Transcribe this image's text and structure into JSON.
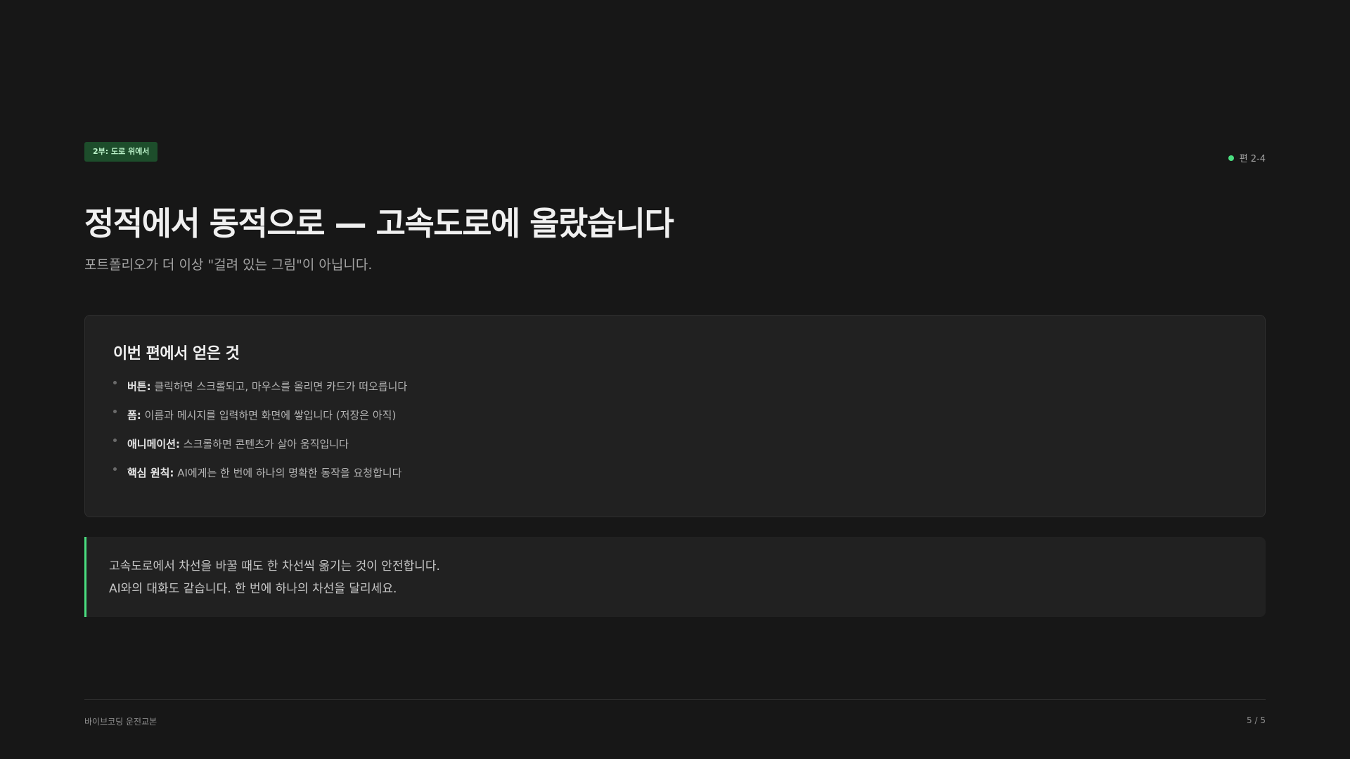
{
  "header": {
    "part_badge": "2부: 도로 위에서",
    "episode_label": "편 2-4"
  },
  "title": "정적에서 동적으로 — 고속도로에 올랐습니다",
  "subtitle": "포트폴리오가 더 이상 \"걸려 있는 그림\"이 아닙니다.",
  "summary_card": {
    "title": "이번 편에서 얻은 것",
    "items": [
      {
        "term": "버튼:",
        "text": " 클릭하면 스크롤되고, 마우스를 올리면 카드가 떠오릅니다"
      },
      {
        "term": "폼:",
        "text": " 이름과 메시지를 입력하면 화면에 쌓입니다 (저장은 아직)"
      },
      {
        "term": "애니메이션:",
        "text": " 스크롤하면 콘텐츠가 살아 움직입니다"
      },
      {
        "term": "핵심 원칙:",
        "text": " AI에게는 한 번에 하나의 명확한 동작을 요청합니다"
      }
    ]
  },
  "quote": {
    "line1": "고속도로에서 차선을 바꿀 때도 한 차선씩 옮기는 것이 안전합니다.",
    "line2": "AI와의 대화도 같습니다. 한 번에 하나의 차선을 달리세요."
  },
  "footer": {
    "book_title": "바이브코딩 운전교본",
    "page_indicator": "5 / 5"
  },
  "colors": {
    "background": "#171717",
    "card": "#212121",
    "accent": "#4ade80",
    "badge_bg": "#1d4d2b"
  }
}
